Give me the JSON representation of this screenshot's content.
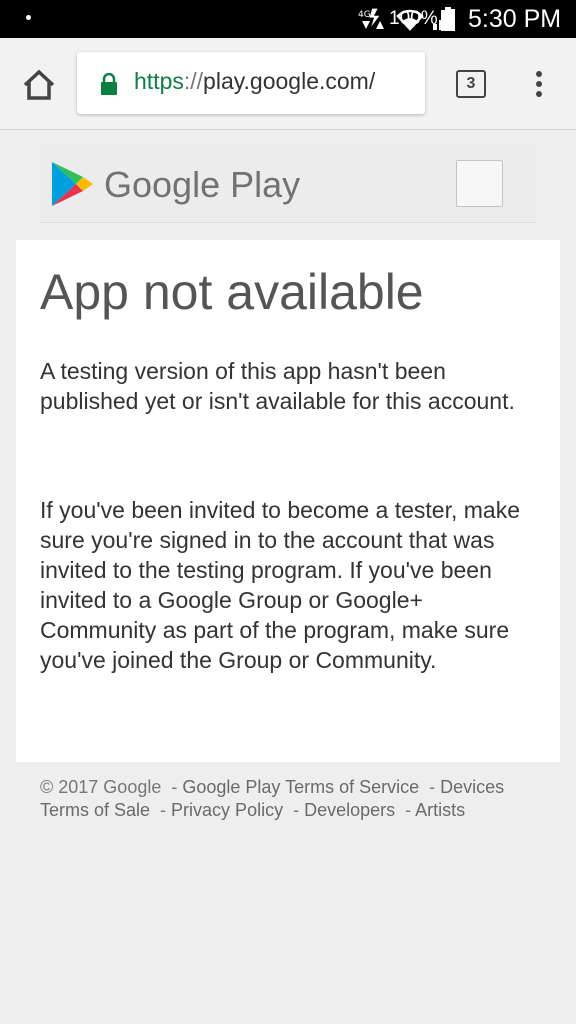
{
  "status_bar": {
    "time": "5:30 PM",
    "battery": "100%"
  },
  "browser": {
    "url_scheme": "https",
    "url_sep": "://",
    "url_host": "play.google.com/",
    "tab_count": "3"
  },
  "header": {
    "brand": "Google Play"
  },
  "main": {
    "title": "App not available",
    "paragraph1": "A testing version of this app hasn't been published yet or isn't available for this account.",
    "paragraph2": "If you've been invited to become a tester, make sure you're signed in to the account that was invited to the testing program. If you've been invited to a Google Group or Google+ Community as part of the program, make sure you've joined the Group or Community."
  },
  "footer": {
    "copyright": "© 2017 Google",
    "links": [
      "Google Play Terms of Service",
      "Devices Terms of Sale",
      "Privacy Policy",
      "Developers",
      "Artists"
    ]
  },
  "colors": {
    "secure_green": "#0b8043",
    "text_dark": "#333333",
    "title_grey": "#555555"
  }
}
